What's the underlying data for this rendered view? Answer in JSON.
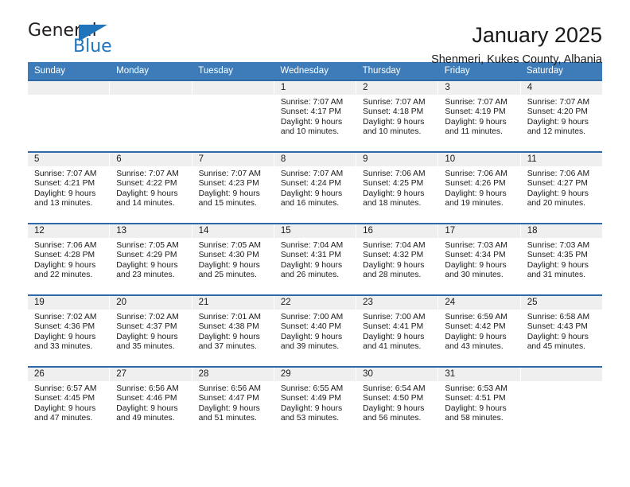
{
  "brand": {
    "name_part1": "General",
    "name_part2": "Blue"
  },
  "header": {
    "month_title": "January 2025",
    "location": "Shenmeri, Kukes County, Albania"
  },
  "theme": {
    "header_blue": "#3d7cb8",
    "row_border_blue": "#2f6aa8",
    "day_number_bg": "#efefef",
    "brand_blue": "#1f74bb"
  },
  "weekdays": [
    "Sunday",
    "Monday",
    "Tuesday",
    "Wednesday",
    "Thursday",
    "Friday",
    "Saturday"
  ],
  "weeks": [
    [
      {
        "day": "",
        "sunrise": "",
        "sunset": "",
        "daylight_line1": "",
        "daylight_line2": "",
        "empty": true
      },
      {
        "day": "",
        "sunrise": "",
        "sunset": "",
        "daylight_line1": "",
        "daylight_line2": "",
        "empty": true
      },
      {
        "day": "",
        "sunrise": "",
        "sunset": "",
        "daylight_line1": "",
        "daylight_line2": "",
        "empty": true
      },
      {
        "day": "1",
        "sunrise": "Sunrise: 7:07 AM",
        "sunset": "Sunset: 4:17 PM",
        "daylight_line1": "Daylight: 9 hours",
        "daylight_line2": "and 10 minutes.",
        "empty": false
      },
      {
        "day": "2",
        "sunrise": "Sunrise: 7:07 AM",
        "sunset": "Sunset: 4:18 PM",
        "daylight_line1": "Daylight: 9 hours",
        "daylight_line2": "and 10 minutes.",
        "empty": false
      },
      {
        "day": "3",
        "sunrise": "Sunrise: 7:07 AM",
        "sunset": "Sunset: 4:19 PM",
        "daylight_line1": "Daylight: 9 hours",
        "daylight_line2": "and 11 minutes.",
        "empty": false
      },
      {
        "day": "4",
        "sunrise": "Sunrise: 7:07 AM",
        "sunset": "Sunset: 4:20 PM",
        "daylight_line1": "Daylight: 9 hours",
        "daylight_line2": "and 12 minutes.",
        "empty": false
      }
    ],
    [
      {
        "day": "5",
        "sunrise": "Sunrise: 7:07 AM",
        "sunset": "Sunset: 4:21 PM",
        "daylight_line1": "Daylight: 9 hours",
        "daylight_line2": "and 13 minutes.",
        "empty": false
      },
      {
        "day": "6",
        "sunrise": "Sunrise: 7:07 AM",
        "sunset": "Sunset: 4:22 PM",
        "daylight_line1": "Daylight: 9 hours",
        "daylight_line2": "and 14 minutes.",
        "empty": false
      },
      {
        "day": "7",
        "sunrise": "Sunrise: 7:07 AM",
        "sunset": "Sunset: 4:23 PM",
        "daylight_line1": "Daylight: 9 hours",
        "daylight_line2": "and 15 minutes.",
        "empty": false
      },
      {
        "day": "8",
        "sunrise": "Sunrise: 7:07 AM",
        "sunset": "Sunset: 4:24 PM",
        "daylight_line1": "Daylight: 9 hours",
        "daylight_line2": "and 16 minutes.",
        "empty": false
      },
      {
        "day": "9",
        "sunrise": "Sunrise: 7:06 AM",
        "sunset": "Sunset: 4:25 PM",
        "daylight_line1": "Daylight: 9 hours",
        "daylight_line2": "and 18 minutes.",
        "empty": false
      },
      {
        "day": "10",
        "sunrise": "Sunrise: 7:06 AM",
        "sunset": "Sunset: 4:26 PM",
        "daylight_line1": "Daylight: 9 hours",
        "daylight_line2": "and 19 minutes.",
        "empty": false
      },
      {
        "day": "11",
        "sunrise": "Sunrise: 7:06 AM",
        "sunset": "Sunset: 4:27 PM",
        "daylight_line1": "Daylight: 9 hours",
        "daylight_line2": "and 20 minutes.",
        "empty": false
      }
    ],
    [
      {
        "day": "12",
        "sunrise": "Sunrise: 7:06 AM",
        "sunset": "Sunset: 4:28 PM",
        "daylight_line1": "Daylight: 9 hours",
        "daylight_line2": "and 22 minutes.",
        "empty": false
      },
      {
        "day": "13",
        "sunrise": "Sunrise: 7:05 AM",
        "sunset": "Sunset: 4:29 PM",
        "daylight_line1": "Daylight: 9 hours",
        "daylight_line2": "and 23 minutes.",
        "empty": false
      },
      {
        "day": "14",
        "sunrise": "Sunrise: 7:05 AM",
        "sunset": "Sunset: 4:30 PM",
        "daylight_line1": "Daylight: 9 hours",
        "daylight_line2": "and 25 minutes.",
        "empty": false
      },
      {
        "day": "15",
        "sunrise": "Sunrise: 7:04 AM",
        "sunset": "Sunset: 4:31 PM",
        "daylight_line1": "Daylight: 9 hours",
        "daylight_line2": "and 26 minutes.",
        "empty": false
      },
      {
        "day": "16",
        "sunrise": "Sunrise: 7:04 AM",
        "sunset": "Sunset: 4:32 PM",
        "daylight_line1": "Daylight: 9 hours",
        "daylight_line2": "and 28 minutes.",
        "empty": false
      },
      {
        "day": "17",
        "sunrise": "Sunrise: 7:03 AM",
        "sunset": "Sunset: 4:34 PM",
        "daylight_line1": "Daylight: 9 hours",
        "daylight_line2": "and 30 minutes.",
        "empty": false
      },
      {
        "day": "18",
        "sunrise": "Sunrise: 7:03 AM",
        "sunset": "Sunset: 4:35 PM",
        "daylight_line1": "Daylight: 9 hours",
        "daylight_line2": "and 31 minutes.",
        "empty": false
      }
    ],
    [
      {
        "day": "19",
        "sunrise": "Sunrise: 7:02 AM",
        "sunset": "Sunset: 4:36 PM",
        "daylight_line1": "Daylight: 9 hours",
        "daylight_line2": "and 33 minutes.",
        "empty": false
      },
      {
        "day": "20",
        "sunrise": "Sunrise: 7:02 AM",
        "sunset": "Sunset: 4:37 PM",
        "daylight_line1": "Daylight: 9 hours",
        "daylight_line2": "and 35 minutes.",
        "empty": false
      },
      {
        "day": "21",
        "sunrise": "Sunrise: 7:01 AM",
        "sunset": "Sunset: 4:38 PM",
        "daylight_line1": "Daylight: 9 hours",
        "daylight_line2": "and 37 minutes.",
        "empty": false
      },
      {
        "day": "22",
        "sunrise": "Sunrise: 7:00 AM",
        "sunset": "Sunset: 4:40 PM",
        "daylight_line1": "Daylight: 9 hours",
        "daylight_line2": "and 39 minutes.",
        "empty": false
      },
      {
        "day": "23",
        "sunrise": "Sunrise: 7:00 AM",
        "sunset": "Sunset: 4:41 PM",
        "daylight_line1": "Daylight: 9 hours",
        "daylight_line2": "and 41 minutes.",
        "empty": false
      },
      {
        "day": "24",
        "sunrise": "Sunrise: 6:59 AM",
        "sunset": "Sunset: 4:42 PM",
        "daylight_line1": "Daylight: 9 hours",
        "daylight_line2": "and 43 minutes.",
        "empty": false
      },
      {
        "day": "25",
        "sunrise": "Sunrise: 6:58 AM",
        "sunset": "Sunset: 4:43 PM",
        "daylight_line1": "Daylight: 9 hours",
        "daylight_line2": "and 45 minutes.",
        "empty": false
      }
    ],
    [
      {
        "day": "26",
        "sunrise": "Sunrise: 6:57 AM",
        "sunset": "Sunset: 4:45 PM",
        "daylight_line1": "Daylight: 9 hours",
        "daylight_line2": "and 47 minutes.",
        "empty": false
      },
      {
        "day": "27",
        "sunrise": "Sunrise: 6:56 AM",
        "sunset": "Sunset: 4:46 PM",
        "daylight_line1": "Daylight: 9 hours",
        "daylight_line2": "and 49 minutes.",
        "empty": false
      },
      {
        "day": "28",
        "sunrise": "Sunrise: 6:56 AM",
        "sunset": "Sunset: 4:47 PM",
        "daylight_line1": "Daylight: 9 hours",
        "daylight_line2": "and 51 minutes.",
        "empty": false
      },
      {
        "day": "29",
        "sunrise": "Sunrise: 6:55 AM",
        "sunset": "Sunset: 4:49 PM",
        "daylight_line1": "Daylight: 9 hours",
        "daylight_line2": "and 53 minutes.",
        "empty": false
      },
      {
        "day": "30",
        "sunrise": "Sunrise: 6:54 AM",
        "sunset": "Sunset: 4:50 PM",
        "daylight_line1": "Daylight: 9 hours",
        "daylight_line2": "and 56 minutes.",
        "empty": false
      },
      {
        "day": "31",
        "sunrise": "Sunrise: 6:53 AM",
        "sunset": "Sunset: 4:51 PM",
        "daylight_line1": "Daylight: 9 hours",
        "daylight_line2": "and 58 minutes.",
        "empty": false
      },
      {
        "day": "",
        "sunrise": "",
        "sunset": "",
        "daylight_line1": "",
        "daylight_line2": "",
        "empty": true
      }
    ]
  ]
}
